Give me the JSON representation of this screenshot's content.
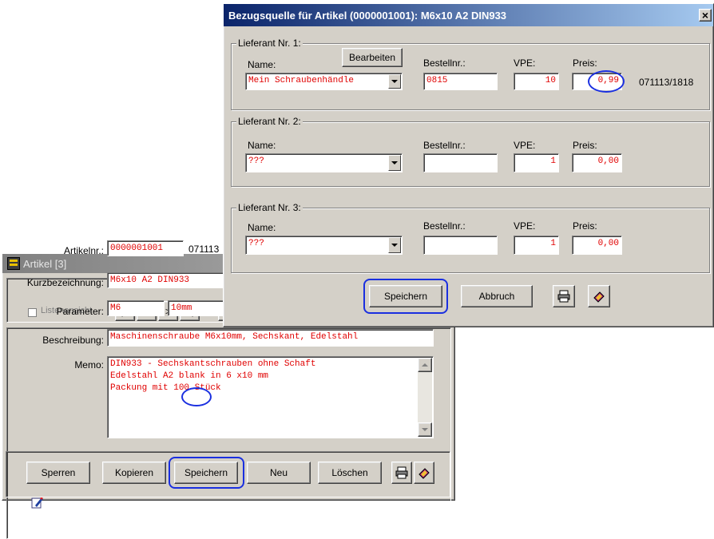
{
  "artikel": {
    "title": "Artikel  [3]",
    "listenansicht": "Listenansicht",
    "nav": [
      "|<",
      "<",
      ">",
      ">|"
    ],
    "artikelnr_label": "Artikelnr.:",
    "artikelnr_value": "0000001001",
    "artikelnr_extra": "071113",
    "kurz_label": "Kurzbezeichnung:",
    "kurz_value": "M6x10 A2 DIN933",
    "parameter_label": "Parameter:",
    "parameter_value1": "M6",
    "parameter_value2": "10mm",
    "beschreibung_label": "Beschreibung:",
    "beschreibung_value": "Maschinenschraube M6x10mm, Sechskant, Edelstahl",
    "memo_label": "Memo:",
    "memo_line1": "DIN933 - Sechskantschrauben ohne Schaft",
    "memo_line2": "Edelstahl A2 blank in 6 x10 mm",
    "memo_line3_pre": "Packung mit ",
    "memo_line3_num": "100",
    "memo_line3_post": " Stück",
    "buttons": {
      "sperren": "Sperren",
      "kopieren": "Kopieren",
      "speichern": "Speichern",
      "neu": "Neu",
      "loeschen": "Löschen"
    }
  },
  "bezug": {
    "title": "Bezugsquelle für Artikel (0000001001): M6x10 A2 DIN933",
    "close": "×",
    "bearbeiten": "Bearbeiten",
    "labels": {
      "name": "Name:",
      "bestellnr": "Bestellnr.:",
      "vpe": "VPE:",
      "preis": "Preis:"
    },
    "lieferanten": [
      {
        "title": "Lieferant Nr. 1:",
        "name": "Mein Schraubenhändle",
        "bestellnr": "0815",
        "vpe": "10",
        "preis": "0,99",
        "extra": "071113/1818"
      },
      {
        "title": "Lieferant Nr. 2:",
        "name": "???",
        "bestellnr": "",
        "vpe": "1",
        "preis": "0,00"
      },
      {
        "title": "Lieferant Nr. 3:",
        "name": "???",
        "bestellnr": "",
        "vpe": "1",
        "preis": "0,00"
      }
    ],
    "buttons": {
      "speichern": "Speichern",
      "abbruch": "Abbruch"
    }
  },
  "colors": {
    "title_blue": "#0a246a",
    "title_gray": "#808080",
    "highlight": "#1a2fe0",
    "field_text": "#e00000"
  },
  "icons": [
    "printer-icon",
    "book-icon",
    "edit-icon",
    "app-icon"
  ]
}
